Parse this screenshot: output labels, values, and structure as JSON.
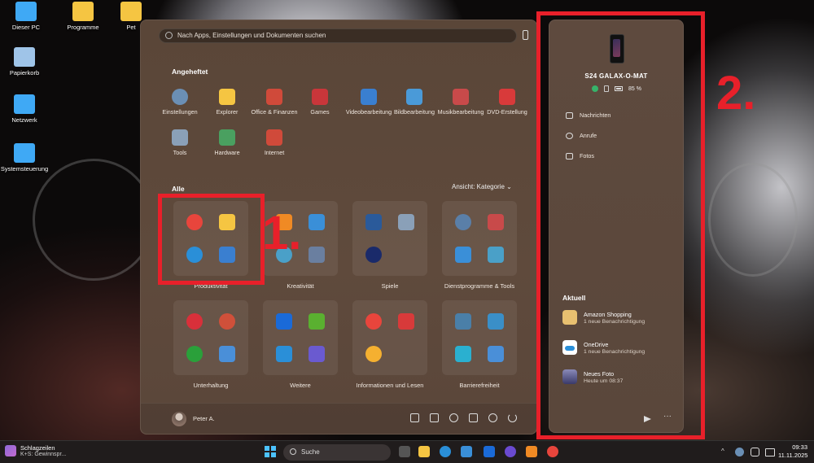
{
  "desktop": {
    "icons": [
      {
        "label": "Dieser PC",
        "color": "#3fa9f5"
      },
      {
        "label": "Programme",
        "color": "#f5c542"
      },
      {
        "label": "Pet",
        "color": "#f5c542"
      },
      {
        "label": "Papierkorb",
        "color": "#9fc4e8"
      },
      {
        "label": "Netzwerk",
        "color": "#3fa9f5"
      },
      {
        "label": "Systemsteuerung",
        "color": "#3fa9f5"
      }
    ]
  },
  "start_menu": {
    "search_placeholder": "Nach Apps, Einstellungen und Dokumenten suchen",
    "pinned_title": "Angeheftet",
    "pinned": [
      {
        "label": "Einstellungen",
        "icon": "gear-icon",
        "color": "#6b8fb5"
      },
      {
        "label": "Explorer",
        "icon": "folder-icon",
        "color": "#f5c542"
      },
      {
        "label": "Office & Finanzen",
        "icon": "office-folder-icon",
        "color": "#d04a3a"
      },
      {
        "label": "Games",
        "icon": "games-folder-icon",
        "color": "#c9363a"
      },
      {
        "label": "Videobearbeitung",
        "icon": "video-folder-icon",
        "color": "#3a7fd0"
      },
      {
        "label": "Bildbearbeitung",
        "icon": "image-folder-icon",
        "color": "#4a9ad8"
      },
      {
        "label": "Musikbearbeitung",
        "icon": "music-folder-icon",
        "color": "#c84a4a"
      },
      {
        "label": "DVD-Erstellung",
        "icon": "dvd-folder-icon",
        "color": "#d83a3a"
      },
      {
        "label": "Tools",
        "icon": "tools-folder-icon",
        "color": "#8aa0b8"
      },
      {
        "label": "Hardware",
        "icon": "hardware-folder-icon",
        "color": "#4aa060"
      },
      {
        "label": "Internet",
        "icon": "internet-folder-icon",
        "color": "#d04a3a"
      }
    ],
    "all_title": "Alle",
    "view_label": "Ansicht: Kategorie",
    "categories": [
      {
        "label": "Produktivität",
        "icons": [
          {
            "name": "chrome-icon",
            "color": "#e8453c",
            "round": true
          },
          {
            "name": "explorer-icon",
            "color": "#f5c542",
            "round": false
          },
          {
            "name": "edge-icon",
            "color": "#2a8fd8",
            "round": true
          },
          {
            "name": "office-icon",
            "color": "#3a7fd0",
            "round": false
          }
        ]
      },
      {
        "label": "Kreativität",
        "icons": [
          {
            "name": "vlc-icon",
            "color": "#f08a24",
            "round": false
          },
          {
            "name": "paint-pen-icon",
            "color": "#3a8fd8",
            "round": false
          },
          {
            "name": "palette-icon",
            "color": "#4aa0c8",
            "round": true
          },
          {
            "name": "photo-settings-icon",
            "color": "#6a7fa0",
            "round": false
          }
        ]
      },
      {
        "label": "Spiele",
        "icons": [
          {
            "name": "solitaire-icon",
            "color": "#2a5a9a",
            "round": false
          },
          {
            "name": "ship-icon",
            "color": "#8aa0b8",
            "round": false
          },
          {
            "name": "game-globe-icon",
            "color": "#1a2a6a",
            "round": true
          }
        ]
      },
      {
        "label": "Dienstprogramme & Tools",
        "icons": [
          {
            "name": "settings-app-icon",
            "color": "#5a7fa8",
            "round": true
          },
          {
            "name": "tools-icon",
            "color": "#c84a4a",
            "round": false
          },
          {
            "name": "store-icon",
            "color": "#3a8fd8",
            "round": false
          },
          {
            "name": "utilities-icon",
            "color": "#4aa0c8",
            "round": false
          }
        ]
      },
      {
        "label": "Unterhaltung",
        "icons": [
          {
            "name": "record-icon",
            "color": "#d8303a",
            "round": true
          },
          {
            "name": "media-player-icon",
            "color": "#d0503a",
            "round": true
          },
          {
            "name": "xbox-icon",
            "color": "#2aa03a",
            "round": true
          },
          {
            "name": "entertainment-icon",
            "color": "#4a8fd8",
            "round": false
          }
        ]
      },
      {
        "label": "Weitere",
        "icons": [
          {
            "name": "r-app-icon",
            "color": "#1a6ad8",
            "round": false
          },
          {
            "name": "nvidia-icon",
            "color": "#5ab030",
            "round": false
          },
          {
            "name": "kodi-icon",
            "color": "#2a8fd8",
            "round": false
          },
          {
            "name": "more-apps-icon",
            "color": "#6a5ad0",
            "round": false
          }
        ]
      },
      {
        "label": "Informationen und Lesen",
        "icons": [
          {
            "name": "maps-icon",
            "color": "#e8453c",
            "round": true
          },
          {
            "name": "news-icon",
            "color": "#d83a3a",
            "round": false
          },
          {
            "name": "weather-icon",
            "color": "#f5b030",
            "round": true
          }
        ]
      },
      {
        "label": "Barrierefreiheit",
        "icons": [
          {
            "name": "magnifier-icon",
            "color": "#4a7fa8",
            "round": false
          },
          {
            "name": "keyboard-icon",
            "color": "#3a8fc8",
            "round": false
          },
          {
            "name": "caption-icon",
            "color": "#2ab0d0",
            "round": false
          },
          {
            "name": "accessibility-icon",
            "color": "#4a8fd8",
            "round": false
          }
        ]
      }
    ],
    "user_name": "Peter A."
  },
  "phone_panel": {
    "device_name": "S24 GALAX-O-MAT",
    "battery": "85 %",
    "items": [
      {
        "label": "Nachrichten",
        "icon": "message-icon"
      },
      {
        "label": "Anrufe",
        "icon": "phone-call-icon"
      },
      {
        "label": "Fotos",
        "icon": "photos-icon"
      }
    ],
    "recent_title": "Aktuell",
    "notifications": [
      {
        "title": "Amazon Shopping",
        "sub": "1 neue Benachrichtigung",
        "color": "#e8c070"
      },
      {
        "title": "OneDrive",
        "sub": "1 neue Benachrichtigung",
        "color": "#2a8fd8"
      },
      {
        "title": "Neues Foto",
        "sub": "Heute um 08:37",
        "color": "#4a4a7a"
      }
    ],
    "more_label": "···"
  },
  "annotations": {
    "label1": "1.",
    "label2": "2.",
    "color": "#e8202a"
  },
  "taskbar": {
    "news_title": "Schlagzeilen",
    "news_sub": "K+S: Gewinnspr...",
    "search_label": "Suche",
    "time": "09:33",
    "date": "11.11.2025",
    "tray_chevron": "^"
  }
}
